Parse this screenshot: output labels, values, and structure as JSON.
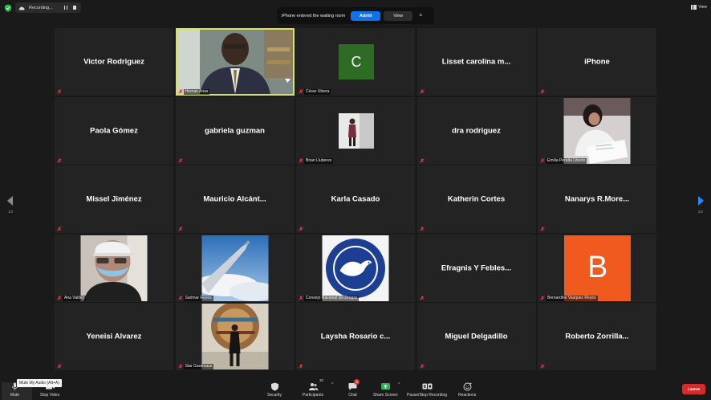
{
  "recording": {
    "label": "Recording..."
  },
  "view_button": {
    "label": "View"
  },
  "notification": {
    "message": "iPhone entered the waiting room",
    "admit_label": "Admit",
    "view_label": "View",
    "close_glyph": "×"
  },
  "pagination": {
    "left": "1/2",
    "right": "1/2"
  },
  "tiles": [
    {
      "display_name": "Victor Rodriguez",
      "label": ""
    },
    {
      "display_name": "",
      "label": "Hernan Arias"
    },
    {
      "display_name": "",
      "label": "César Ubiera",
      "avatar": "C",
      "avatar_color": "#2e6b24"
    },
    {
      "display_name": "Lisset carolina m...",
      "label": ""
    },
    {
      "display_name": "iPhone",
      "label": ""
    },
    {
      "display_name": "Paola Gómez",
      "label": ""
    },
    {
      "display_name": "gabriela guzman",
      "label": ""
    },
    {
      "display_name": "",
      "label": "Brian Lluberes"
    },
    {
      "display_name": "dra rodriguez",
      "label": ""
    },
    {
      "display_name": "",
      "label": "Emilia Peralta Liberio"
    },
    {
      "display_name": "Missel Jiménez",
      "label": ""
    },
    {
      "display_name": "Mauricio  Alcánt...",
      "label": ""
    },
    {
      "display_name": "Karla Casado",
      "label": ""
    },
    {
      "display_name": "Katherin Cortes",
      "label": ""
    },
    {
      "display_name": "Nanarys  R.More...",
      "label": ""
    },
    {
      "display_name": "",
      "label": "Ana Valdez"
    },
    {
      "display_name": "",
      "label": "Sarimar Reyes"
    },
    {
      "display_name": "",
      "label": "Consejo Nacional De Drogas"
    },
    {
      "display_name": "Efragnis Y Febles...",
      "label": ""
    },
    {
      "display_name": "",
      "label": "Bernardino Vasquez Reyes",
      "avatar": "B",
      "avatar_color": "#f05a1f"
    },
    {
      "display_name": "Yeneisi Alvarez",
      "label": ""
    },
    {
      "display_name": "",
      "label": "Star Gautreaux"
    },
    {
      "display_name": "Laysha Rosario c...",
      "label": ""
    },
    {
      "display_name": "Miguel Delgadillo",
      "label": ""
    },
    {
      "display_name": "Roberto  Zorrilla...",
      "label": ""
    }
  ],
  "toolbar": {
    "mute_label": "Mute",
    "mute_tooltip": "Mute My Audio (Alt+A)",
    "video_label": "Stop Video",
    "security_label": "Security",
    "participants_label": "Participants",
    "participants_count": "30",
    "chat_label": "Chat",
    "chat_badge": "3",
    "share_label": "Share Screen",
    "recording_label": "Pause/Stop Recording",
    "reactions_label": "Reactions",
    "leave_label": "Leave"
  },
  "colors": {
    "accent_blue": "#0e72ed",
    "leave_red": "#d62b2b",
    "active_speaker": "#d9e35a",
    "share_green": "#1db954"
  }
}
